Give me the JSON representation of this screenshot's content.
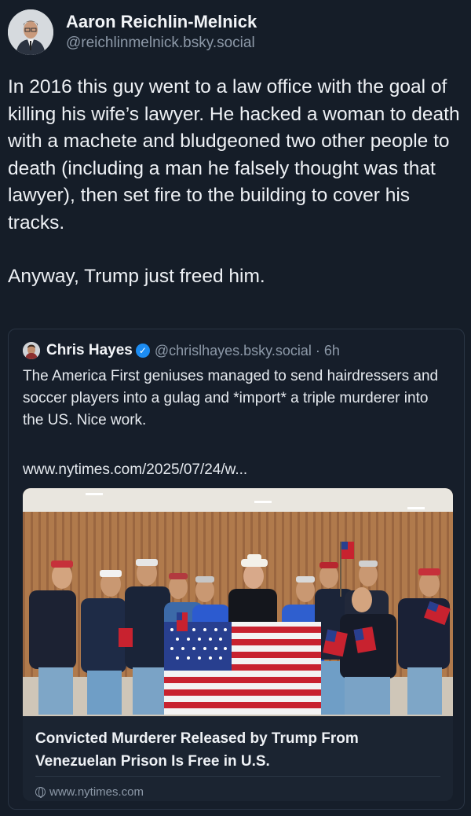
{
  "author": {
    "display_name": "Aaron Reichlin-Melnick",
    "handle": "@reichlinmelnick.bsky.social"
  },
  "post": {
    "paragraph_1": "In 2016 this guy went to a law office with the goal of killing his wife’s lawyer. He hacked a woman to death with a machete and bludgeoned two other people to death (including a man he falsely thought was that lawyer), then set fire to the building to cover his tracks.",
    "paragraph_2": "Anyway, Trump just freed him."
  },
  "quote": {
    "name": "Chris Hayes",
    "handle_time": "@chrislhayes.bsky.social · 6h",
    "text": "The America First geniuses managed to send hairdressers and soccer players into a gulag and *import* a triple murderer into the US. Nice work.",
    "link": "www.nytimes.com/2025/07/24/w...",
    "embed": {
      "title": "Convicted Murderer Released by Trump From Venezuelan Prison Is Free in U.S.",
      "domain": "www.nytimes.com"
    }
  },
  "icons": {
    "verified": "verified-badge-icon",
    "domain": "globe-icon"
  },
  "colors": {
    "background": "#151d28",
    "verified": "#1c8cf2",
    "muted_text": "#8d99a8"
  }
}
